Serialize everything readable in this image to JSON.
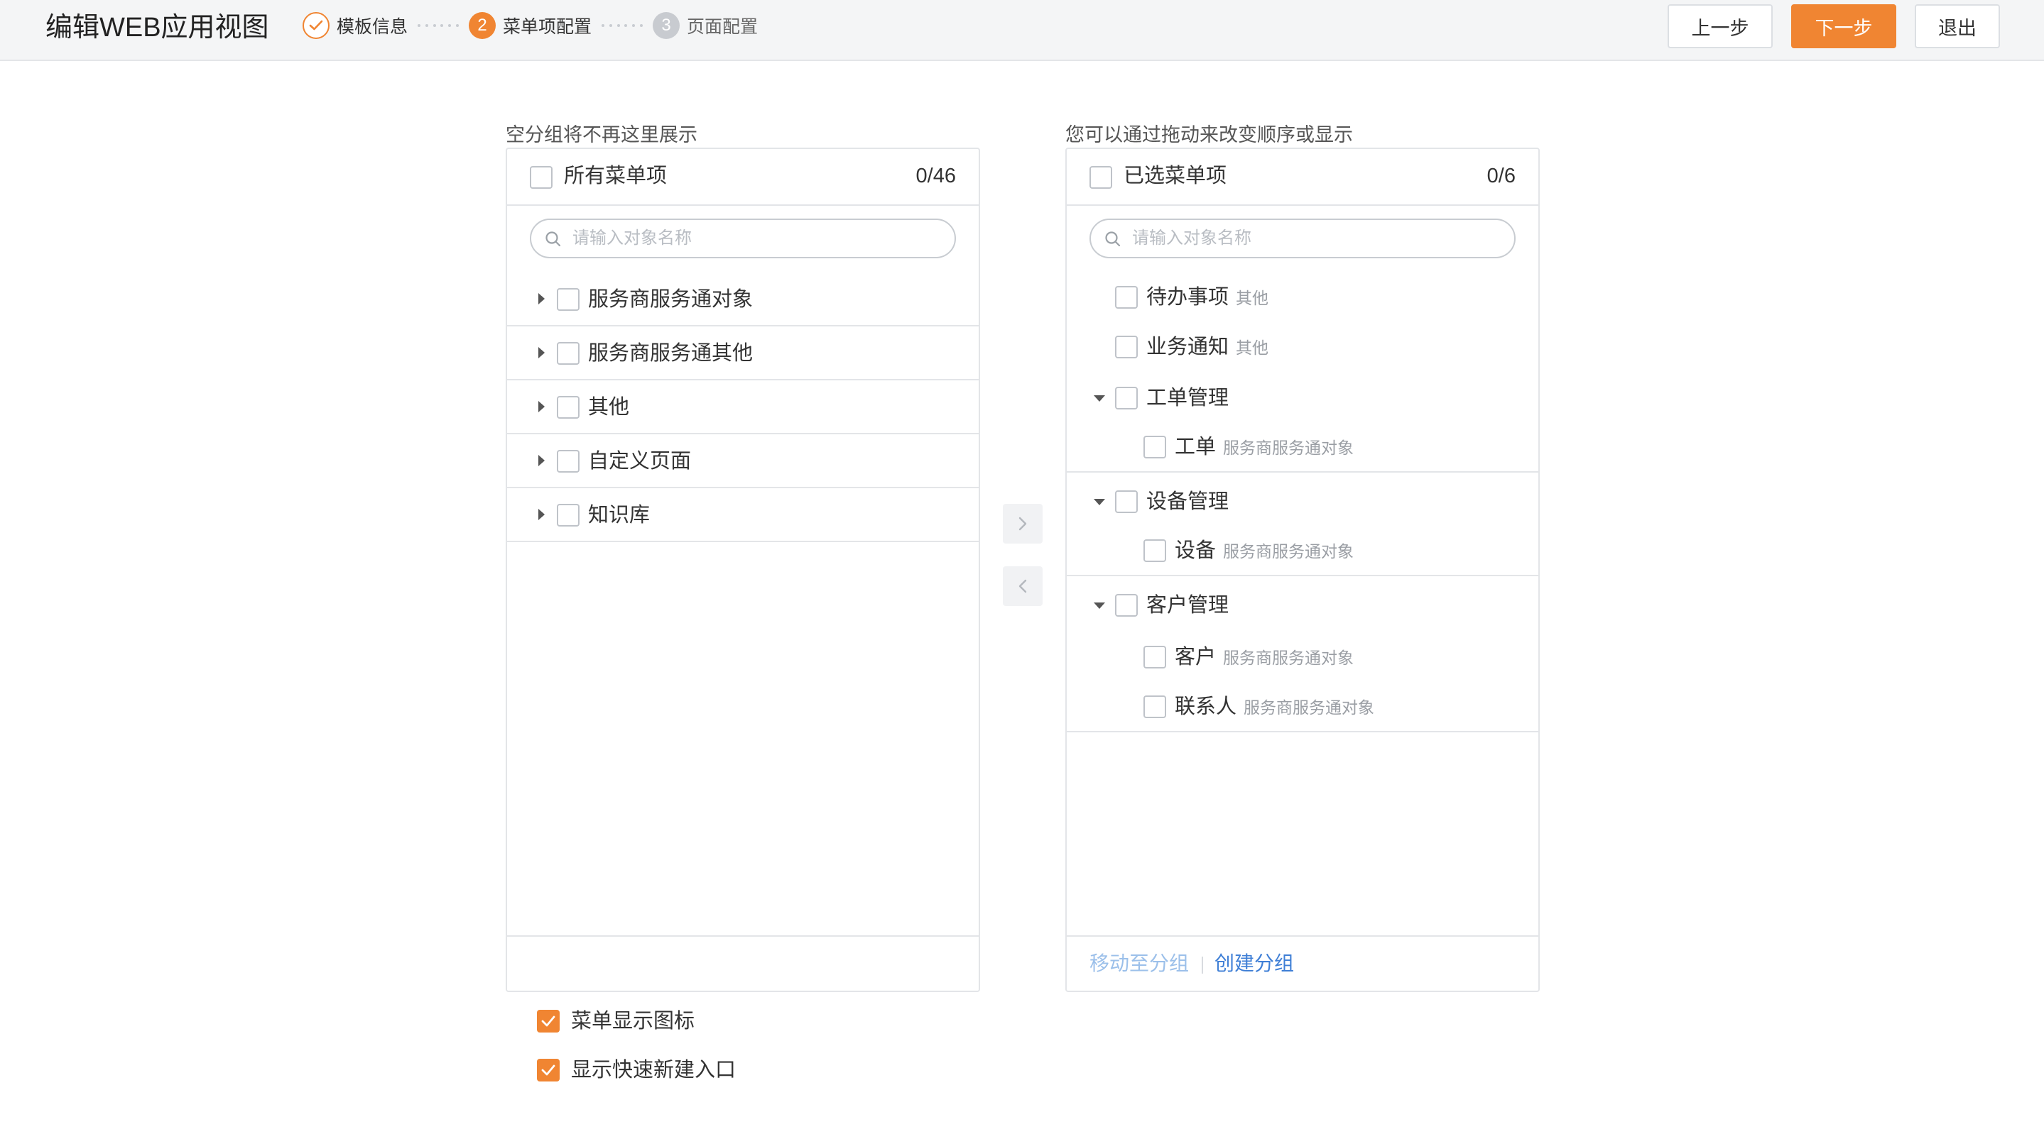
{
  "header": {
    "title": "编辑WEB应用视图",
    "steps": [
      {
        "number": "",
        "label": "模板信息",
        "state": "done"
      },
      {
        "number": "2",
        "label": "菜单项配置",
        "state": "active"
      },
      {
        "number": "3",
        "label": "页面配置",
        "state": "pending"
      }
    ],
    "prev_label": "上一步",
    "next_label": "下一步",
    "exit_label": "退出"
  },
  "left_panel": {
    "caption": "空分组将不再这里展示",
    "title": "所有菜单项",
    "count": "0/46",
    "search_placeholder": "请输入对象名称",
    "items": [
      {
        "label": "服务商服务通对象"
      },
      {
        "label": "服务商服务通其他"
      },
      {
        "label": "其他"
      },
      {
        "label": "自定义页面"
      },
      {
        "label": "知识库"
      }
    ]
  },
  "right_panel": {
    "caption": "您可以通过拖动来改变顺序或显示",
    "title": "已选菜单项",
    "count": "0/6",
    "search_placeholder": "请输入对象名称",
    "items": [
      {
        "label": "待办事项",
        "sub": "其他"
      },
      {
        "label": "业务通知",
        "sub": "其他"
      }
    ],
    "groups": [
      {
        "label": "工单管理",
        "children": [
          {
            "label": "工单",
            "sub": "服务商服务通对象"
          }
        ]
      },
      {
        "label": "设备管理",
        "children": [
          {
            "label": "设备",
            "sub": "服务商服务通对象"
          }
        ]
      },
      {
        "label": "客户管理",
        "children": [
          {
            "label": "客户",
            "sub": "服务商服务通对象"
          },
          {
            "label": "联系人",
            "sub": "服务商服务通对象"
          }
        ]
      }
    ],
    "move_link": "移动至分组",
    "create_link": "创建分组"
  },
  "options": [
    {
      "label": "菜单显示图标",
      "checked": true
    },
    {
      "label": "显示快速新建入口",
      "checked": true
    }
  ],
  "colors": {
    "accent": "#f08532",
    "link": "#3f7fd6",
    "link_disabled": "#9cc0ea",
    "border": "#e3e5e8"
  },
  "icons": {
    "done_step": "check-icon",
    "search": "search-icon",
    "expand": "caret-right-icon",
    "collapse": "caret-down-icon",
    "transfer_right": "chevron-right-icon",
    "transfer_left": "chevron-left-icon"
  }
}
